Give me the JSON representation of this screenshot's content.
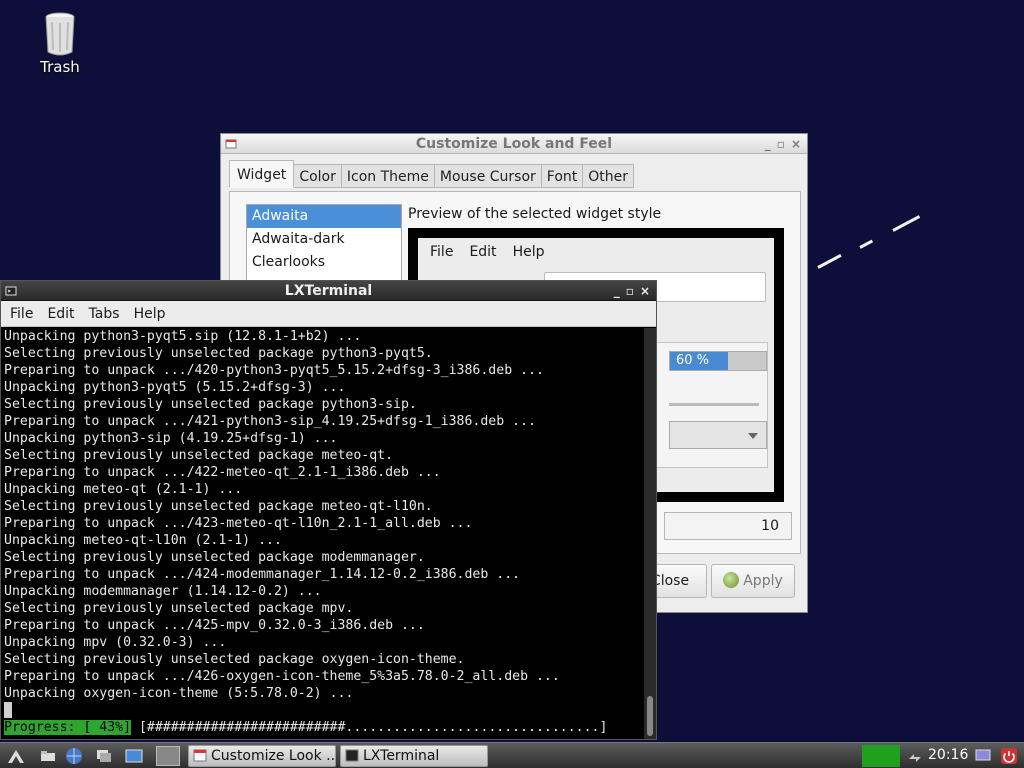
{
  "desktop": {
    "trash_label": "Trash"
  },
  "customize_window": {
    "title": "Customize Look and Feel",
    "controls": [
      "_",
      "▫",
      "×"
    ],
    "tabs": [
      "Widget",
      "Color",
      "Icon Theme",
      "Mouse Cursor",
      "Font",
      "Other"
    ],
    "selected_tab": "Widget",
    "themes": [
      "Adwaita",
      "Adwaita-dark",
      "Clearlooks"
    ],
    "selected_theme": "Adwaita",
    "preview_label": "Preview of the selected widget style",
    "preview": {
      "menu": [
        "File",
        "Edit",
        "Help"
      ],
      "progress_text": "60 %",
      "progress_value": 0.6
    },
    "spin_value": "10",
    "close_label": "Close",
    "apply_label": "Apply"
  },
  "terminal": {
    "title": "LXTerminal",
    "menu": [
      "File",
      "Edit",
      "Tabs",
      "Help"
    ],
    "lines": [
      "Unpacking python3-pyqt5.sip (12.8.1-1+b2) ...",
      "Selecting previously unselected package python3-pyqt5.",
      "Preparing to unpack .../420-python3-pyqt5_5.15.2+dfsg-3_i386.deb ...",
      "Unpacking python3-pyqt5 (5.15.2+dfsg-3) ...",
      "Selecting previously unselected package python3-sip.",
      "Preparing to unpack .../421-python3-sip_4.19.25+dfsg-1_i386.deb ...",
      "Unpacking python3-sip (4.19.25+dfsg-1) ...",
      "Selecting previously unselected package meteo-qt.",
      "Preparing to unpack .../422-meteo-qt_2.1-1_i386.deb ...",
      "Unpacking meteo-qt (2.1-1) ...",
      "Selecting previously unselected package meteo-qt-l10n.",
      "Preparing to unpack .../423-meteo-qt-l10n_2.1-1_all.deb ...",
      "Unpacking meteo-qt-l10n (2.1-1) ...",
      "Selecting previously unselected package modemmanager.",
      "Preparing to unpack .../424-modemmanager_1.14.12-0.2_i386.deb ...",
      "Unpacking modemmanager (1.14.12-0.2) ...",
      "Selecting previously unselected package mpv.",
      "Preparing to unpack .../425-mpv_0.32.0-3_i386.deb ...",
      "Unpacking mpv (0.32.0-3) ...",
      "Selecting previously unselected package oxygen-icon-theme.",
      "Preparing to unpack .../426-oxygen-icon-theme_5%3a5.78.0-2_all.deb ...",
      "Unpacking oxygen-icon-theme (5:5.78.0-2) ..."
    ],
    "progress_label": "Progress: [ 43%]",
    "progress_bar": " [#########################................................] "
  },
  "taskbar": {
    "tasks": [
      "Customize Look ...",
      "LXTerminal"
    ],
    "clock": "20:16"
  },
  "colors": {
    "desktop_bg": "#0d0f3a",
    "selection": "#4a90d9",
    "progress_green": "#2ea52e"
  }
}
